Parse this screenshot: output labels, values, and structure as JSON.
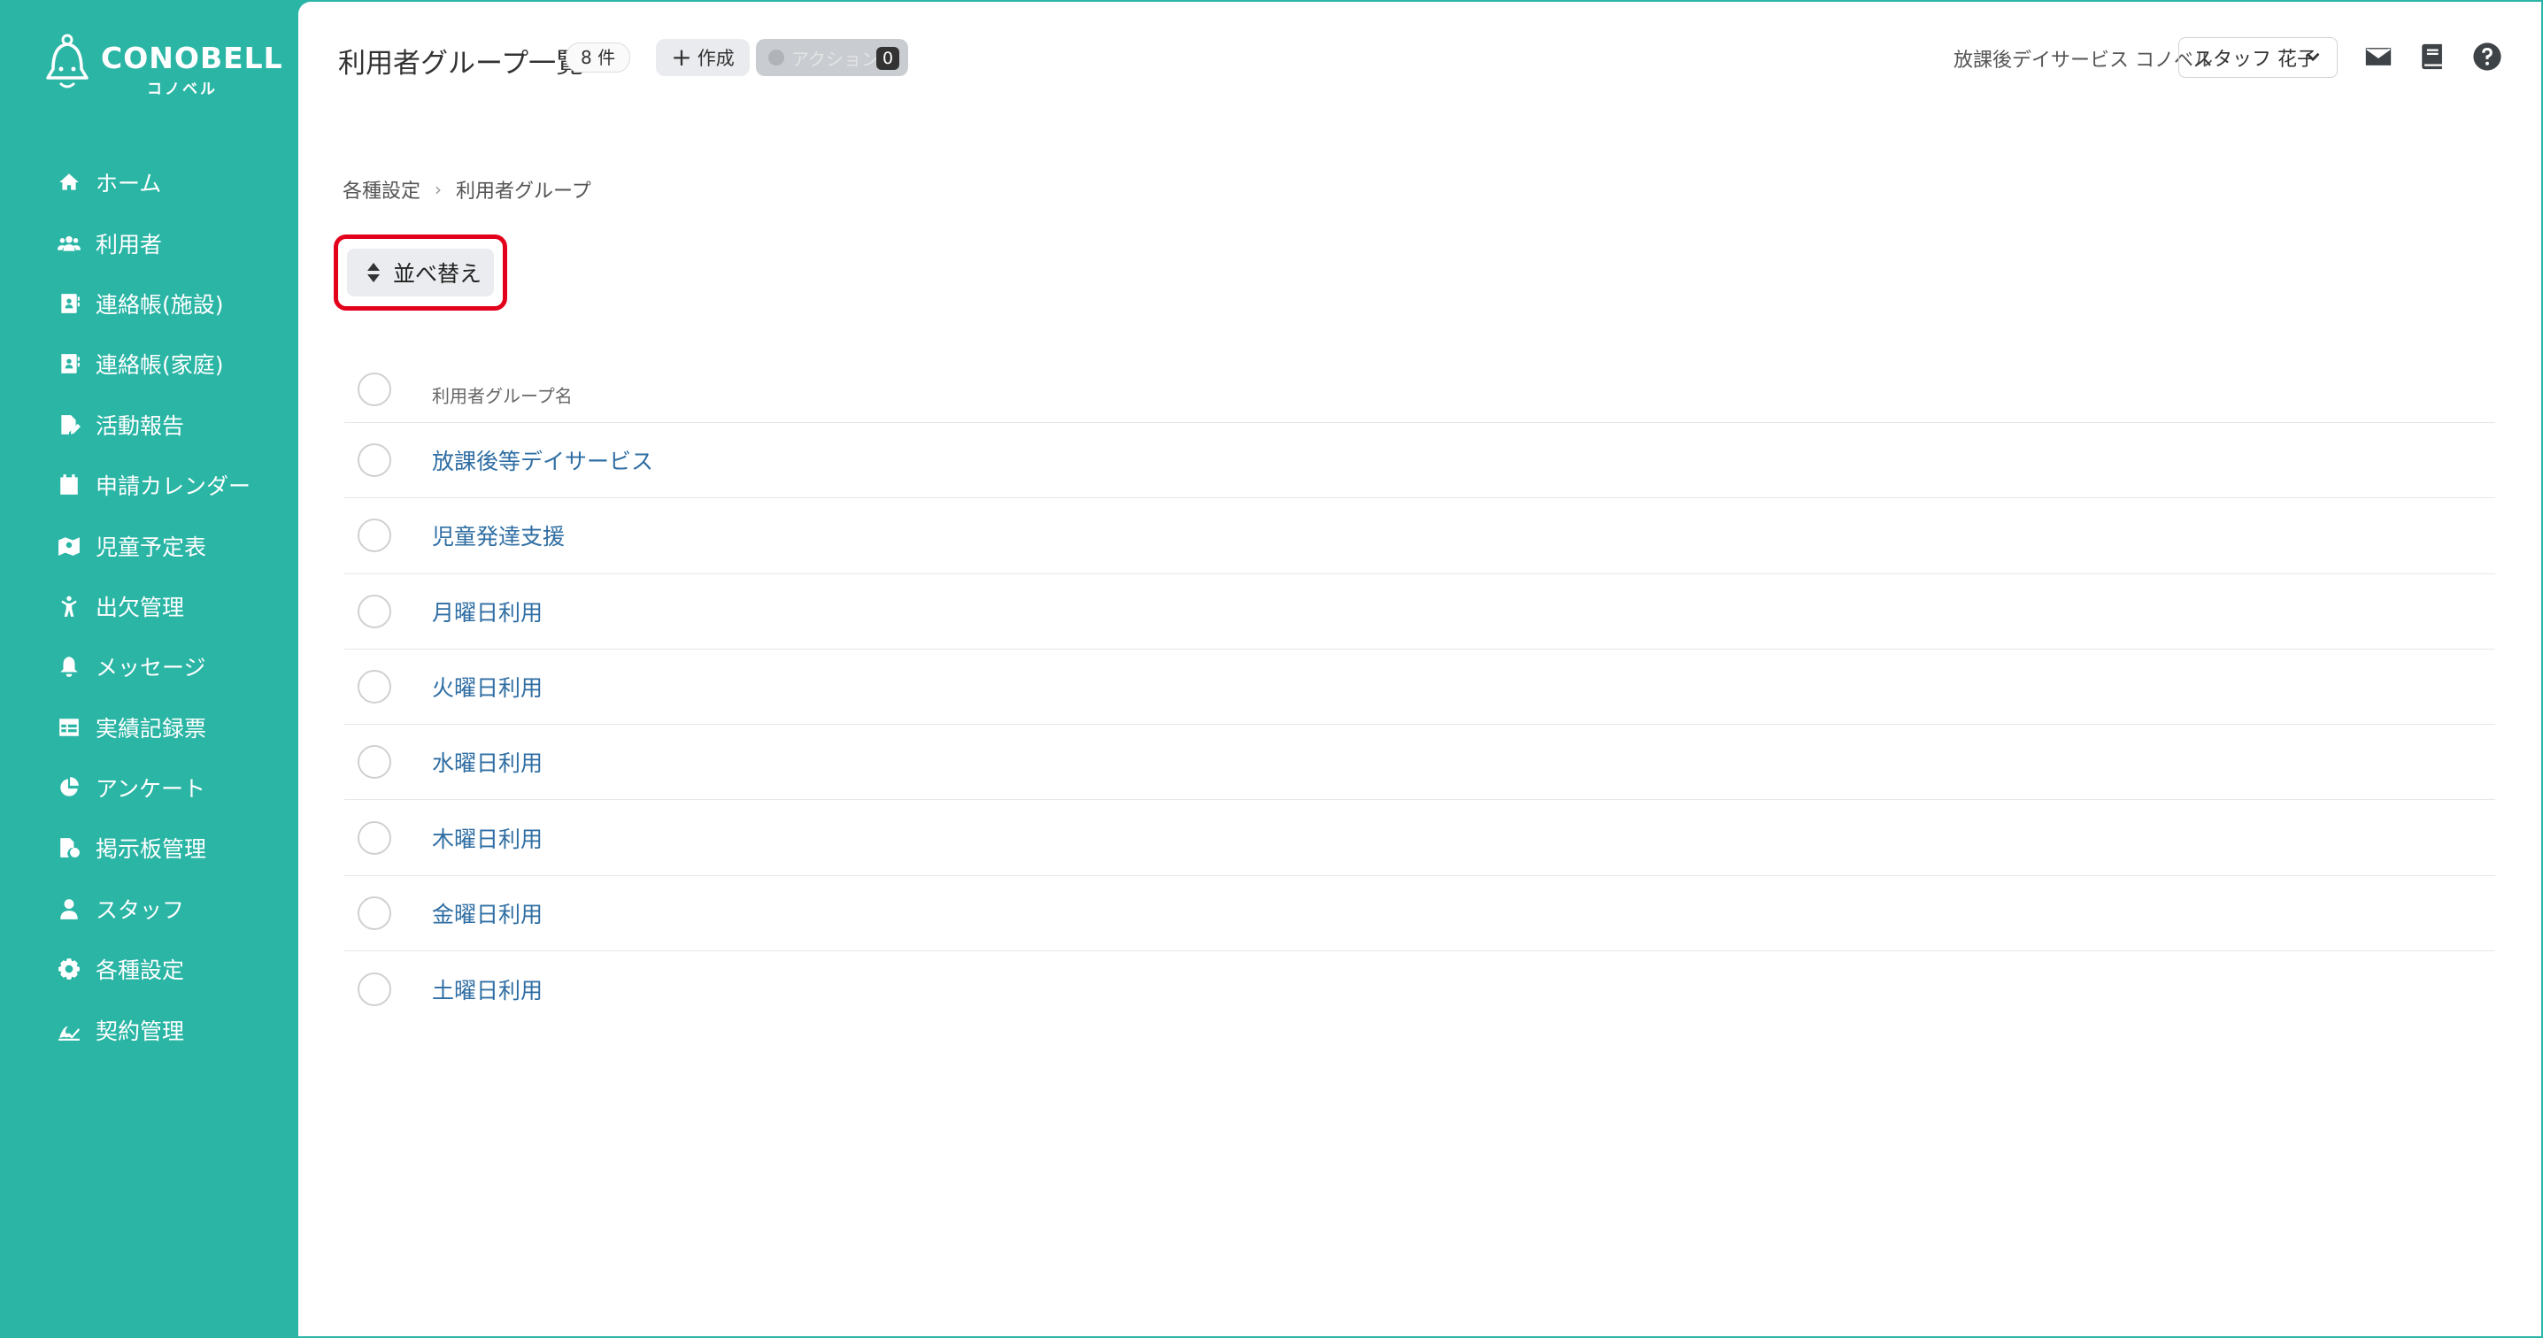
{
  "brand": {
    "name": "CONOBELL",
    "sub": "コノベル"
  },
  "sidebar": {
    "items": [
      {
        "label": "ホーム",
        "icon": "home-icon"
      },
      {
        "label": "利用者",
        "icon": "users-icon"
      },
      {
        "label": "連絡帳(施設)",
        "icon": "contact-book-icon"
      },
      {
        "label": "連絡帳(家庭)",
        "icon": "contact-book-icon"
      },
      {
        "label": "活動報告",
        "icon": "file-edit-icon"
      },
      {
        "label": "申請カレンダー",
        "icon": "calendar-icon"
      },
      {
        "label": "児童予定表",
        "icon": "schedule-map-icon"
      },
      {
        "label": "出欠管理",
        "icon": "person-attendance-icon"
      },
      {
        "label": "メッセージ",
        "icon": "bell-icon"
      },
      {
        "label": "実績記録票",
        "icon": "table-icon"
      },
      {
        "label": "アンケート",
        "icon": "pie-chart-icon"
      },
      {
        "label": "掲示板管理",
        "icon": "board-icon"
      },
      {
        "label": "スタッフ",
        "icon": "staff-icon"
      },
      {
        "label": "各種設定",
        "icon": "gear-icon"
      },
      {
        "label": "契約管理",
        "icon": "contract-icon"
      }
    ]
  },
  "header": {
    "title": "利用者グループ一覧",
    "count": "8 件",
    "create_label": "作成",
    "action_label": "アクション",
    "action_count": "0",
    "facility": "放課後デイサービス コノベル",
    "staff": "スタッフ 花子"
  },
  "breadcrumb": {
    "parent": "各種設定",
    "current": "利用者グループ"
  },
  "sort_button": {
    "label": "並べ替え"
  },
  "table": {
    "header": "利用者グループ名",
    "rows": [
      "放課後等デイサービス",
      "児童発達支援",
      "月曜日利用",
      "火曜日利用",
      "水曜日利用",
      "木曜日利用",
      "金曜日利用",
      "土曜日利用"
    ]
  },
  "colors": {
    "brand": "#2ab5a5",
    "highlight": "#e3001b",
    "link": "#2f6ea3"
  }
}
